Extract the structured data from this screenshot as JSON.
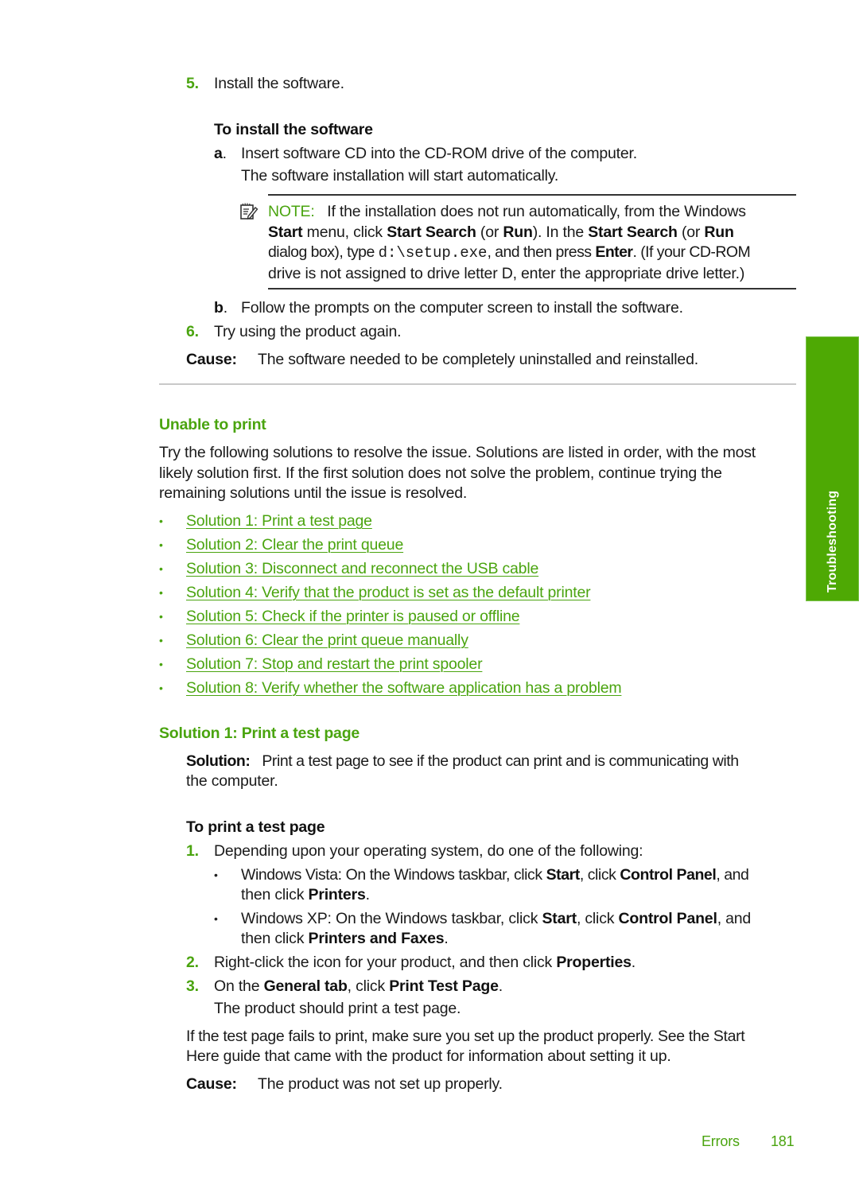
{
  "step5": {
    "num": "5.",
    "text": "Install the software."
  },
  "install_heading": "To install the software",
  "step_a": {
    "letter": "a",
    "line1": "Insert software CD into the CD-ROM drive of the computer.",
    "line2": "The software installation will start automatically."
  },
  "note": {
    "icon": "note-pencil-icon",
    "label": "NOTE:",
    "line1": "If the installation does not run automatically, from the Windows",
    "line2": {
      "b1": "Start",
      "t1": " menu, click ",
      "b2": "Start Search",
      "t2": " (or ",
      "b3": "Run",
      "t3": "). In the ",
      "b4": "Start Search",
      "t4": " (or ",
      "b5": "Run"
    },
    "line3": {
      "t1": "dialog box), type ",
      "code": "d:\\setup.exe",
      "t2": ", and then press ",
      "b1": "Enter",
      "t3": ". (If your CD-ROM"
    },
    "line4": "drive is not assigned to drive letter D, enter the appropriate drive letter.)"
  },
  "step_b": {
    "letter": "b",
    "text": "Follow the prompts on the computer screen to install the software."
  },
  "step6": {
    "num": "6.",
    "text": "Try using the product again."
  },
  "cause1": {
    "label": "Cause:",
    "text": "The software needed to be completely uninstalled and reinstalled."
  },
  "unable_heading": "Unable to print",
  "intro": {
    "line1": "Try the following solutions to resolve the issue. Solutions are listed in order, with the most",
    "line2": "likely solution first. If the first solution does not solve the problem, continue trying the",
    "line3": "remaining solutions until the issue is resolved."
  },
  "solutions": [
    "Solution 1: Print a test page",
    "Solution 2: Clear the print queue",
    "Solution 3: Disconnect and reconnect the USB cable",
    "Solution 4: Verify that the product is set as the default printer",
    "Solution 5: Check if the printer is paused or offline",
    "Solution 6: Clear the print queue manually",
    "Solution 7: Stop and restart the print spooler",
    "Solution 8: Verify whether the software application has a problem"
  ],
  "sol1_heading": "Solution 1: Print a test page",
  "sol1": {
    "label": "Solution:",
    "line1": "Print a test page to see if the product can print and is communicating with",
    "line2": "the computer."
  },
  "print_heading": "To print a test page",
  "p_step1": {
    "num": "1.",
    "text": "Depending upon your operating system, do one of the following:"
  },
  "vista": {
    "t1": "Windows Vista: On the Windows taskbar, click ",
    "b1": "Start",
    "t2": ", click ",
    "b2": "Control Panel",
    "t3": ", and",
    "t4": "then click ",
    "b3": "Printers",
    "t5": "."
  },
  "xp": {
    "t1": "Windows XP: On the Windows taskbar, click ",
    "b1": "Start",
    "t2": ", click ",
    "b2": "Control Panel",
    "t3": ", and",
    "t4": "then click ",
    "b3": "Printers and Faxes",
    "t5": "."
  },
  "p_step2": {
    "num": "2.",
    "t1": "Right-click the icon for your product, and then click ",
    "b1": "Properties",
    "t2": "."
  },
  "p_step3": {
    "num": "3.",
    "t1": "On the ",
    "b1": "General tab",
    "t2": ", click ",
    "b2": "Print Test Page",
    "t3": ".",
    "line2": "The product should print a test page."
  },
  "fail": {
    "line1": "If the test page fails to print, make sure you set up the product properly. See the Start",
    "line2": "Here guide that came with the product for information about setting it up."
  },
  "cause2": {
    "label": "Cause:",
    "text": "The product was not set up properly."
  },
  "side_tab": "Troubleshooting",
  "footer": {
    "section": "Errors",
    "page": "181"
  }
}
